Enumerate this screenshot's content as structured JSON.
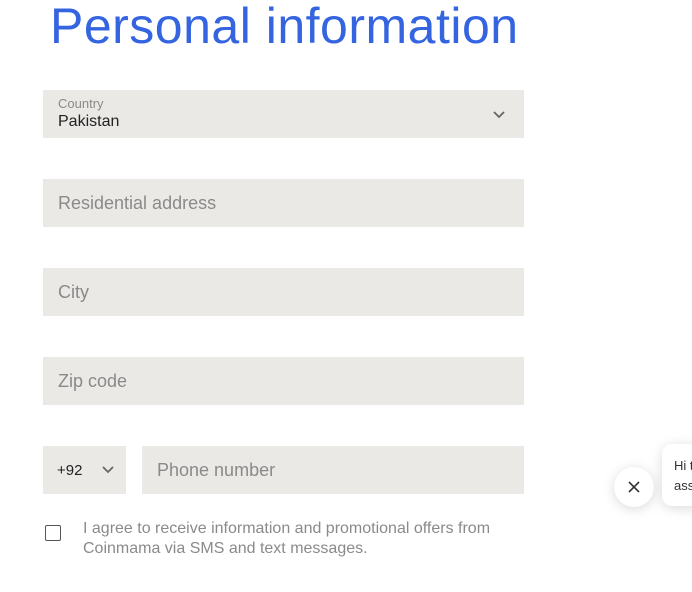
{
  "header": {
    "title": "Personal information"
  },
  "form": {
    "country": {
      "label": "Country",
      "value": "Pakistan"
    },
    "residential_address": {
      "placeholder": "Residential address"
    },
    "city": {
      "placeholder": "City"
    },
    "zip_code": {
      "placeholder": "Zip code"
    },
    "phone": {
      "country_code": "+92",
      "placeholder": "Phone number"
    },
    "sms_consent": {
      "label": "I agree to receive information and promotional offers from Coinmama via SMS and text messages.",
      "checked": false
    }
  },
  "chat_widget": {
    "preview_line1": "Hi t",
    "preview_line2": "ass"
  },
  "colors": {
    "title": "#3464e0",
    "field_background": "#ebe9e6",
    "placeholder": "#8a8a8a"
  },
  "icons": {
    "select_chevron": "chevron-down-icon",
    "chat_close": "close-icon",
    "checkbox": "checkbox-unchecked"
  }
}
